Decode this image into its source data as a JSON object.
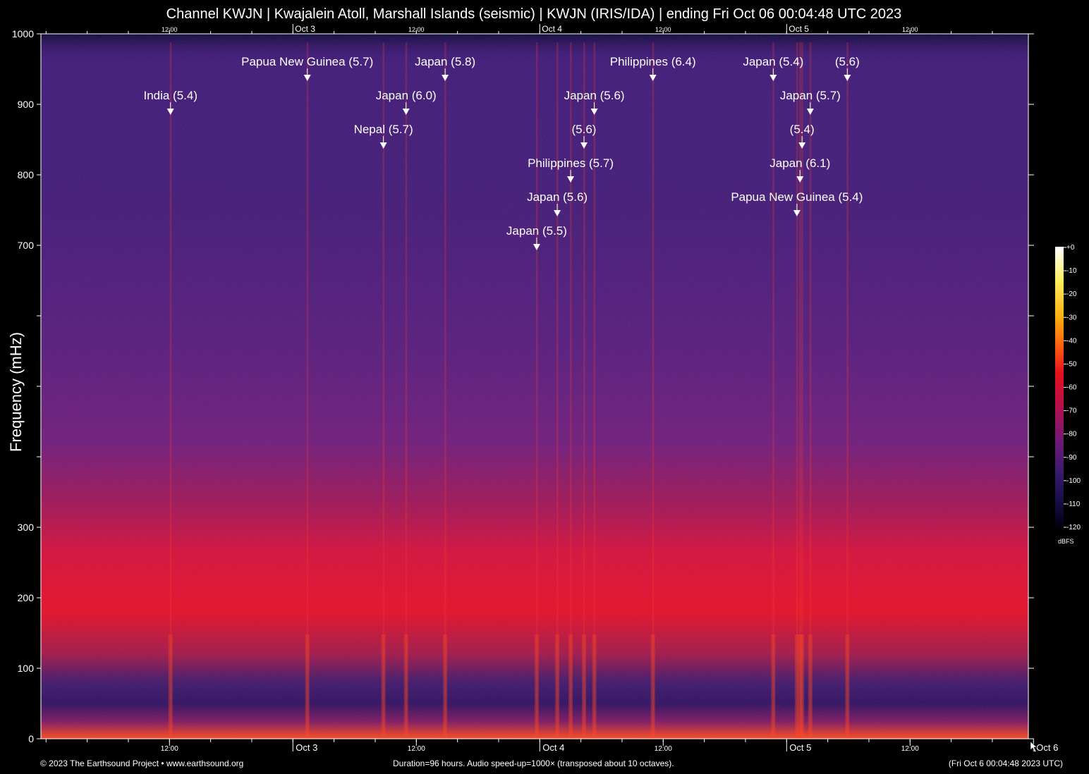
{
  "header": {
    "title": "Channel KWJN | Kwajalein Atoll, Marshall Islands (seismic) | KWJN (IRIS/IDA) | ending Fri Oct 06 00:04:48 UTC 2023"
  },
  "footer": {
    "copyright": "© 2023 The Earthsound Project • www.earthsound.org",
    "duration": "Duration=96 hours. Audio speed-up=1000× (transposed about 10 octaves).",
    "end_time": "(Fri Oct  6 00:04:48 2023 UTC)"
  },
  "colors": {
    "background": "#000000",
    "plot_base": "#3a1868",
    "noise_band_low": "#e0101a",
    "hot_bottom": "#ff5a10"
  },
  "chart_data": {
    "type": "heatmap",
    "title": "Channel KWJN | Kwajalein Atoll, Marshall Islands (seismic) | KWJN (IRIS/IDA) | ending Fri Oct 06 00:04:48 UTC 2023",
    "ylabel": "Frequency (mHz)",
    "ylim": [
      0,
      1000
    ],
    "xlim_hours": [
      0,
      96
    ],
    "y_ticks": [
      0,
      100,
      200,
      300,
      700,
      800,
      900,
      1000
    ],
    "y_minor_ticks": [
      400,
      500,
      600
    ],
    "x_ticks_bottom": [
      {
        "label": "12:00",
        "hour": 12.5
      },
      {
        "label": "Oct  3",
        "hour": 24.5
      },
      {
        "label": "12:00",
        "hour": 36.5
      },
      {
        "label": "Oct  4",
        "hour": 48.5
      },
      {
        "label": "12:00",
        "hour": 60.5
      },
      {
        "label": "Oct  5",
        "hour": 72.5
      },
      {
        "label": "12:00",
        "hour": 84.5
      },
      {
        "label": "Oct  6",
        "hour": 96.5
      }
    ],
    "x_ticks_top": [
      {
        "label": "12:00",
        "hour": 12.5
      },
      {
        "label": "Oct  3",
        "hour": 24.5
      },
      {
        "label": "12:00",
        "hour": 36.5
      },
      {
        "label": "Oct  4",
        "hour": 48.5
      },
      {
        "label": "12:00",
        "hour": 60.5
      },
      {
        "label": "Oct  5",
        "hour": 72.5
      },
      {
        "label": "12:00",
        "hour": 84.5
      }
    ],
    "events": [
      {
        "label": "Papua New Guinea (5.7)",
        "hour": 25.9,
        "row": 0
      },
      {
        "label": "Japan (5.8)",
        "hour": 39.3,
        "row": 0
      },
      {
        "label": "Philippines (6.4)",
        "hour": 59.5,
        "row": 0
      },
      {
        "label": "Japan (5.4)",
        "hour": 71.2,
        "row": 0
      },
      {
        "label": "(5.6)",
        "hour": 78.4,
        "row": 0
      },
      {
        "label": "India (5.4)",
        "hour": 12.6,
        "row": 1
      },
      {
        "label": "Japan (6.0)",
        "hour": 35.5,
        "row": 1
      },
      {
        "label": "Japan (5.6)",
        "hour": 53.8,
        "row": 1
      },
      {
        "label": "Japan (5.7)",
        "hour": 74.8,
        "row": 1
      },
      {
        "label": "Nepal (5.7)",
        "hour": 33.3,
        "row": 2
      },
      {
        "label": "(5.6)",
        "hour": 52.8,
        "row": 2
      },
      {
        "label": "(5.4)",
        "hour": 74.0,
        "row": 2
      },
      {
        "label": "Philippines (5.7)",
        "hour": 51.5,
        "row": 3
      },
      {
        "label": "Japan (6.1)",
        "hour": 73.8,
        "row": 3
      },
      {
        "label": "Japan (5.6)",
        "hour": 50.2,
        "row": 4
      },
      {
        "label": "Papua New Guinea (5.4)",
        "hour": 73.5,
        "row": 4
      },
      {
        "label": "Japan (5.5)",
        "hour": 48.2,
        "row": 5
      }
    ],
    "colorbar": {
      "unit": "dBFS",
      "range": [
        -120,
        0
      ],
      "ticks": [
        "+0",
        "-10",
        "-20",
        "-30",
        "-40",
        "-50",
        "-60",
        "-70",
        "-80",
        "-90",
        "-100",
        "-110",
        "-120"
      ]
    },
    "grid": false
  }
}
